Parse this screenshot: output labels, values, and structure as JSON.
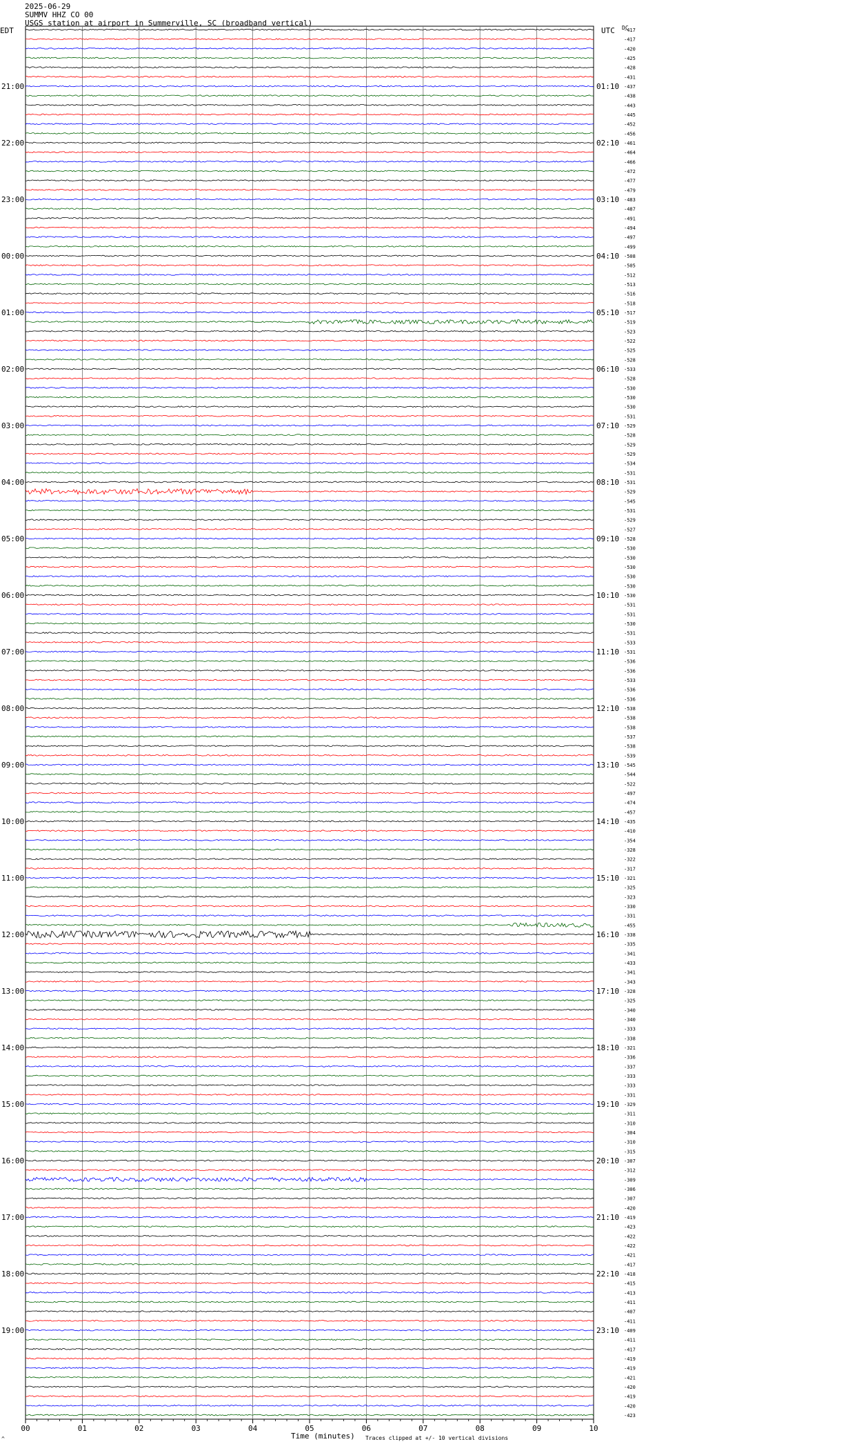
{
  "header": {
    "date": "2025-06-29",
    "channel": "SUMMV HHZ CO 00",
    "station": "USGS station at airport in Summerville, SC (broadband vertical)"
  },
  "left_tz": "EDT",
  "right_tz": "UTC",
  "right_tz_extra": "DC",
  "footer": {
    "xlabel": "Time (minutes)",
    "clip_note": "Traces clipped at +/- 10 vertical divisions",
    "corner_mark": "^"
  },
  "colors": {
    "black": "#000000",
    "red": "#ff0000",
    "blue": "#0000ff",
    "green": "#006400",
    "grid": "#707070"
  },
  "chart_data": {
    "type": "line",
    "title": "USGS station at airport in Summerville, SC (broadband vertical)",
    "xlabel": "Time (minutes)",
    "ylabel": "",
    "xlim": [
      0,
      10
    ],
    "x_ticks": [
      "00",
      "01",
      "02",
      "03",
      "04",
      "05",
      "06",
      "07",
      "08",
      "09",
      "10"
    ],
    "trace_minutes": 15,
    "trace_count": 96,
    "color_cycle": [
      "black",
      "red",
      "blue",
      "green"
    ],
    "left_time_labels": [
      "21:00",
      "22:00",
      "23:00",
      "00:00",
      "01:00",
      "02:00",
      "03:00",
      "04:00",
      "05:00",
      "06:00",
      "07:00",
      "08:00",
      "09:00",
      "10:00",
      "11:00",
      "12:00",
      "13:00",
      "14:00",
      "15:00",
      "16:00",
      "17:00",
      "18:00",
      "19:00"
    ],
    "right_time_labels": [
      "01:10",
      "02:10",
      "03:10",
      "04:10",
      "05:10",
      "06:10",
      "07:10",
      "08:10",
      "09:10",
      "10:10",
      "11:10",
      "12:10",
      "13:10",
      "14:10",
      "15:10",
      "16:10",
      "17:10",
      "18:10",
      "19:10",
      "20:10",
      "21:10",
      "22:10",
      "23:10"
    ],
    "trace_offsets": [
      "-417",
      "-417",
      "-420",
      "-425",
      "-428",
      "-431",
      "-437",
      "-438",
      "-443",
      "-445",
      "-452",
      "-456",
      "-461",
      "-464",
      "-466",
      "-472",
      "-477",
      "-479",
      "-483",
      "-487",
      "-491",
      "-494",
      "-497",
      "-499",
      "-508",
      "-505",
      "-512",
      "-513",
      "-516",
      "-518",
      "-517",
      "-519",
      "-523",
      "-522",
      "-525",
      "-528",
      "-533",
      "-528",
      "-530",
      "-530",
      "-530",
      "-531",
      "-529",
      "-528",
      "-529",
      "-529",
      "-534",
      "-531",
      "-531",
      "-529",
      "-545",
      "-531",
      "-529",
      "-527",
      "-528",
      "-530",
      "-530",
      "-530",
      "-530",
      "-530",
      "-530",
      "-531",
      "-531",
      "-530",
      "-531",
      "-533",
      "-531",
      "-536",
      "-536",
      "-533",
      "-536",
      "-536",
      "-538",
      "-538",
      "-538",
      "-537",
      "-538",
      "-539",
      "-545",
      "-544",
      "-522",
      "-497",
      "-474",
      "-457",
      "-435",
      "-410",
      "-354",
      "-328",
      "-322",
      "-317",
      "-321",
      "-325",
      "-323",
      "-330",
      "-331",
      "-455"
    ],
    "extra_offsets": [
      "-338",
      "-335",
      "-341",
      "-433",
      "-341",
      "-343",
      "-328",
      "-325",
      "-340",
      "-340",
      "-333",
      "-338",
      "-321",
      "-336",
      "-337",
      "-333",
      "-333",
      "-331",
      "-329",
      "-311",
      "-310",
      "-304",
      "-310",
      "-315",
      "-307",
      "-312",
      "-309",
      "-306",
      "-307",
      "-420",
      "-419",
      "-423",
      "-422",
      "-422",
      "-421",
      "-417",
      "-418",
      "-415",
      "-413",
      "-411",
      "-407",
      "-411",
      "-409",
      "-411",
      "-417",
      "-419",
      "-419",
      "-421",
      "-420",
      "-419",
      "-420",
      "-423"
    ],
    "events": [
      {
        "trace": 31,
        "start_min": 5.0,
        "end_min": 10.0,
        "amplitude": 3.0
      },
      {
        "trace": 49,
        "start_min": 0.0,
        "end_min": 4.0,
        "amplitude": 4.0
      },
      {
        "trace": 95,
        "start_min": 8.5,
        "end_min": 10.0,
        "amplitude": 3.0
      },
      {
        "trace": 96,
        "start_min": 0.0,
        "end_min": 5.0,
        "amplitude": 5.0
      },
      {
        "trace": 122,
        "start_min": 0.0,
        "end_min": 6.0,
        "amplitude": 3.0
      }
    ]
  }
}
